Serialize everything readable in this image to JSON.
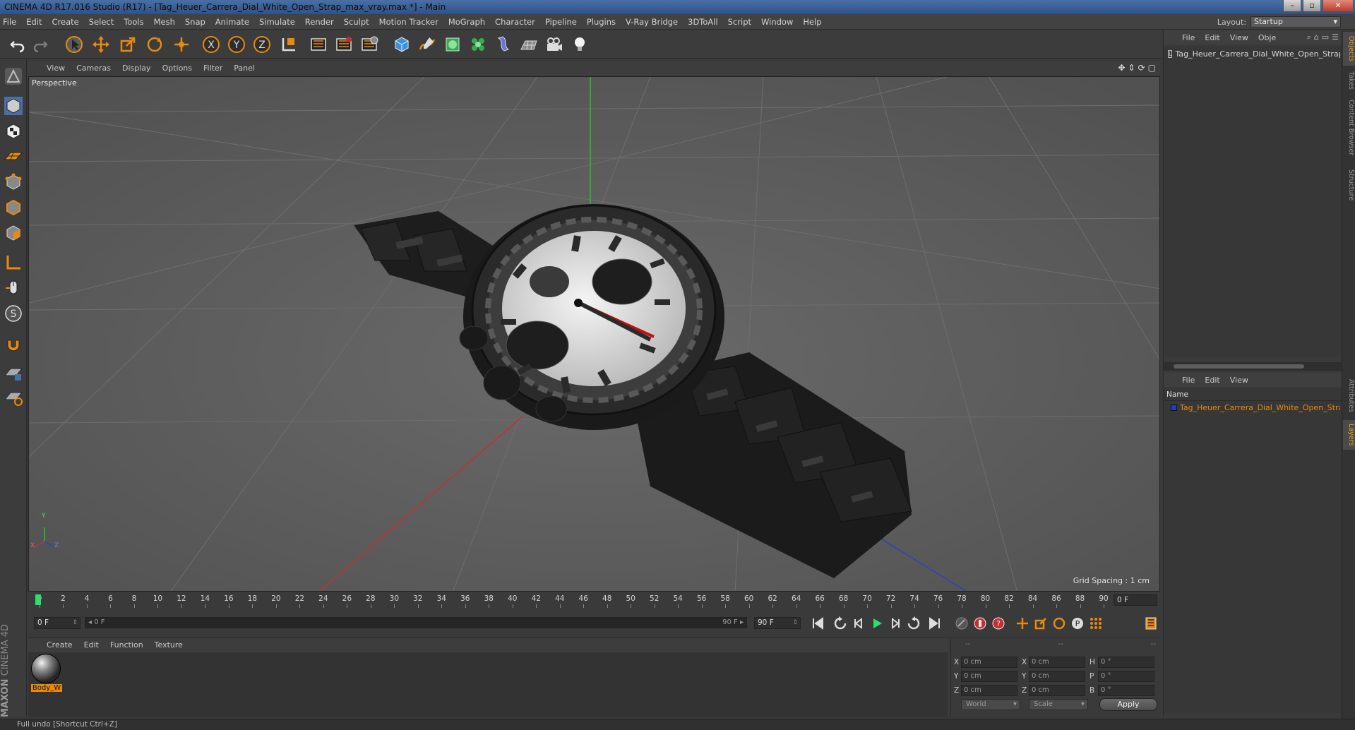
{
  "window": {
    "title": "CINEMA 4D R17.016 Studio (R17) - [Tag_Heuer_Carrera_Dial_White_Open_Strap_max_vray.max *] - Main",
    "minimize": "–",
    "maximize": "▫",
    "close": "✕"
  },
  "menubar": {
    "items": [
      "File",
      "Edit",
      "Create",
      "Select",
      "Tools",
      "Mesh",
      "Snap",
      "Animate",
      "Simulate",
      "Render",
      "Sculpt",
      "Motion Tracker",
      "MoGraph",
      "Character",
      "Pipeline",
      "Plugins",
      "V-Ray Bridge",
      "3DToAll",
      "Script",
      "Window",
      "Help"
    ],
    "layout_label": "Layout:",
    "layout_value": "Startup"
  },
  "viewport": {
    "menu": [
      "View",
      "Cameras",
      "Display",
      "Options",
      "Filter",
      "Panel"
    ],
    "label": "Perspective",
    "grid_spacing": "Grid Spacing : 1 cm",
    "axis_y": "Y",
    "axis_x": "X",
    "axis_z": "Z"
  },
  "timeline": {
    "ticks": [
      "0",
      "2",
      "4",
      "6",
      "8",
      "10",
      "12",
      "14",
      "16",
      "18",
      "20",
      "22",
      "24",
      "26",
      "28",
      "30",
      "32",
      "34",
      "36",
      "38",
      "40",
      "42",
      "44",
      "46",
      "48",
      "50",
      "52",
      "54",
      "56",
      "58",
      "60",
      "62",
      "64",
      "66",
      "68",
      "70",
      "72",
      "74",
      "76",
      "78",
      "80",
      "82",
      "84",
      "86",
      "88",
      "90"
    ],
    "current_frame": "0 F",
    "start_field": "0 F",
    "slider_start": "◂ 0 F",
    "slider_end": "90 F ▸",
    "end_field": "90 F"
  },
  "material_manager": {
    "menu": [
      "Create",
      "Edit",
      "Function",
      "Texture"
    ],
    "materials": [
      {
        "name": "Body_W"
      }
    ]
  },
  "coordinates": {
    "header": [
      "--",
      "--",
      "--"
    ],
    "rows": [
      {
        "a": "X",
        "v1": "0 cm",
        "b": "X",
        "v2": "0 cm",
        "c": "H",
        "v3": "0 °"
      },
      {
        "a": "Y",
        "v1": "0 cm",
        "b": "Y",
        "v2": "0 cm",
        "c": "P",
        "v3": "0 °"
      },
      {
        "a": "Z",
        "v1": "0 cm",
        "b": "Z",
        "v2": "0 cm",
        "c": "B",
        "v3": "0 °"
      }
    ],
    "space": "World",
    "mode": "Scale",
    "apply": "Apply"
  },
  "object_manager": {
    "menu": [
      "File",
      "Edit",
      "View",
      "Obje"
    ],
    "objects": [
      {
        "name": "Tag_Heuer_Carrera_Dial_White_Open_Strap"
      }
    ]
  },
  "layer_manager": {
    "menu": [
      "File",
      "Edit",
      "View"
    ],
    "column": "Name",
    "layers": [
      {
        "name": "Tag_Heuer_Carrera_Dial_White_Open_Strap",
        "color": "#1f3fbf"
      }
    ]
  },
  "right_tabs": [
    "Objects",
    "Takes",
    "Content Browser",
    "Structure",
    "Attributes",
    "Layers"
  ],
  "brand": {
    "maxon": "MAXON",
    "product": "CINEMA 4D"
  },
  "status": "Full undo [Shortcut Ctrl+Z]",
  "colors": {
    "accent": "#e98a0f",
    "playhead": "#2ddf6a",
    "axis_x": "#c43030",
    "axis_y": "#2fbf2f",
    "axis_z": "#3040c0"
  }
}
